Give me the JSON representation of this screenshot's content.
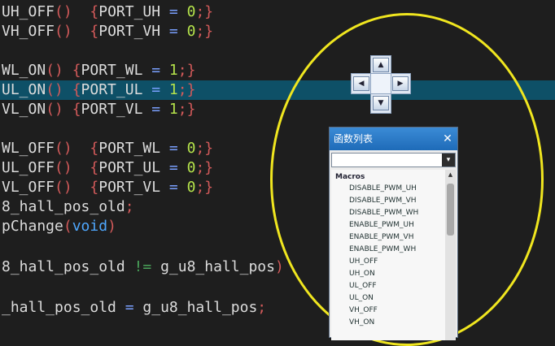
{
  "code": {
    "lines": [
      {
        "t": [
          [
            "UH_OFF",
            "tok-id"
          ],
          [
            "()  ",
            "tok-p"
          ],
          [
            "{",
            "tok-p"
          ],
          [
            "PORT_UH",
            "tok-id"
          ],
          [
            " = ",
            "tok-op"
          ],
          [
            "0",
            "tok-num"
          ],
          [
            ";",
            "tok-p"
          ],
          [
            "}",
            "tok-p"
          ]
        ]
      },
      {
        "t": [
          [
            "VH_OFF",
            "tok-id"
          ],
          [
            "()  ",
            "tok-p"
          ],
          [
            "{",
            "tok-p"
          ],
          [
            "PORT_VH",
            "tok-id"
          ],
          [
            " = ",
            "tok-op"
          ],
          [
            "0",
            "tok-num"
          ],
          [
            ";",
            "tok-p"
          ],
          [
            "}",
            "tok-p"
          ]
        ]
      },
      {
        "t": []
      },
      {
        "t": [
          [
            "WL_ON",
            "tok-id"
          ],
          [
            "() ",
            "tok-p"
          ],
          [
            "{",
            "tok-p"
          ],
          [
            "PORT_WL",
            "tok-id"
          ],
          [
            " = ",
            "tok-op"
          ],
          [
            "1",
            "tok-num"
          ],
          [
            ";",
            "tok-p"
          ],
          [
            "}",
            "tok-p"
          ]
        ]
      },
      {
        "t": [
          [
            "UL_ON",
            "tok-id"
          ],
          [
            "() ",
            "tok-p"
          ],
          [
            "{",
            "tok-p"
          ],
          [
            "PORT_UL",
            "tok-id"
          ],
          [
            " = ",
            "tok-op"
          ],
          [
            "1",
            "tok-num"
          ],
          [
            ";",
            "tok-p"
          ],
          [
            "}",
            "tok-p"
          ]
        ]
      },
      {
        "t": [
          [
            "VL_ON",
            "tok-id"
          ],
          [
            "() ",
            "tok-p"
          ],
          [
            "{",
            "tok-p"
          ],
          [
            "PORT_VL",
            "tok-id"
          ],
          [
            " = ",
            "tok-op"
          ],
          [
            "1",
            "tok-num"
          ],
          [
            ";",
            "tok-p"
          ],
          [
            "}",
            "tok-p"
          ]
        ]
      },
      {
        "t": []
      },
      {
        "t": [
          [
            "WL_OFF",
            "tok-id"
          ],
          [
            "()  ",
            "tok-p"
          ],
          [
            "{",
            "tok-p"
          ],
          [
            "PORT_WL",
            "tok-id"
          ],
          [
            " = ",
            "tok-op"
          ],
          [
            "0",
            "tok-num"
          ],
          [
            ";",
            "tok-p"
          ],
          [
            "}",
            "tok-p"
          ]
        ]
      },
      {
        "t": [
          [
            "UL_OFF",
            "tok-id"
          ],
          [
            "()  ",
            "tok-p"
          ],
          [
            "{",
            "tok-p"
          ],
          [
            "PORT_UL",
            "tok-id"
          ],
          [
            " = ",
            "tok-op"
          ],
          [
            "0",
            "tok-num"
          ],
          [
            ";",
            "tok-p"
          ],
          [
            "}",
            "tok-p"
          ]
        ]
      },
      {
        "t": [
          [
            "VL_OFF",
            "tok-id"
          ],
          [
            "()  ",
            "tok-p"
          ],
          [
            "{",
            "tok-p"
          ],
          [
            "PORT_VL",
            "tok-id"
          ],
          [
            " = ",
            "tok-op"
          ],
          [
            "0",
            "tok-num"
          ],
          [
            ";",
            "tok-p"
          ],
          [
            "}",
            "tok-p"
          ]
        ]
      },
      {
        "t": [
          [
            "8_hall_pos_old",
            "tok-id"
          ],
          [
            ";",
            "tok-p"
          ]
        ]
      },
      {
        "t": [
          [
            "pChange",
            "tok-id"
          ],
          [
            "(",
            "tok-p"
          ],
          [
            "void",
            "tok-kw"
          ],
          [
            ")",
            "tok-p"
          ]
        ]
      },
      {
        "t": []
      },
      {
        "t": [
          [
            "8_hall_pos_old",
            "tok-id"
          ],
          [
            " != ",
            "tok-neq"
          ],
          [
            "g_u8_hall_pos",
            "tok-id"
          ],
          [
            ")",
            "tok-p"
          ]
        ]
      },
      {
        "t": []
      },
      {
        "t": [
          [
            "_hall_pos_old",
            "tok-id"
          ],
          [
            " = ",
            "tok-op"
          ],
          [
            "g_u8_hall_pos",
            "tok-id"
          ],
          [
            ";",
            "tok-p"
          ]
        ]
      }
    ]
  },
  "dock_guide": {
    "icons": [
      "dock-top-icon",
      "dock-left-icon",
      "dock-right-icon",
      "dock-bottom-icon"
    ]
  },
  "function_list": {
    "title": "函数列表",
    "close_label": "✕",
    "filter_value": "",
    "dropdown_icon": "▾",
    "category": "Macros",
    "items": [
      "DISABLE_PWM_UH",
      "DISABLE_PWM_VH",
      "DISABLE_PWM_WH",
      "ENABLE_PWM_UH",
      "ENABLE_PWM_VH",
      "ENABLE_PWM_WH",
      "UH_OFF",
      "UH_ON",
      "UL_OFF",
      "UL_ON",
      "VH_OFF",
      "VH_ON"
    ]
  },
  "colors": {
    "editor_bg": "#1e1e1e",
    "current_line": "#0e5067",
    "annotation": "#f0e61f",
    "panel_title": "#1e6bb8"
  }
}
